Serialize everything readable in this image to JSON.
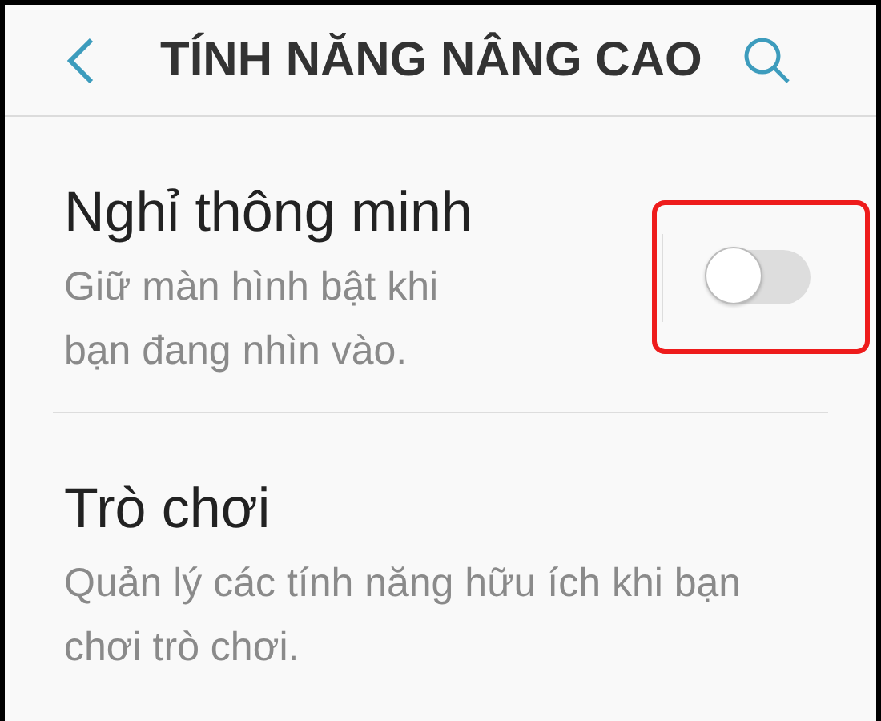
{
  "header": {
    "title": "TÍNH NĂNG NÂNG CAO"
  },
  "settings": [
    {
      "title": "Nghỉ thông minh",
      "description": "Giữ màn hình bật khi bạn đang nhìn vào.",
      "kind": "switch",
      "on": false,
      "highlighted": true
    },
    {
      "title": "Trò chơi",
      "description": "Quản lý các tính năng hữu ích khi bạn chơi trò chơi.",
      "kind": "plain"
    }
  ]
}
